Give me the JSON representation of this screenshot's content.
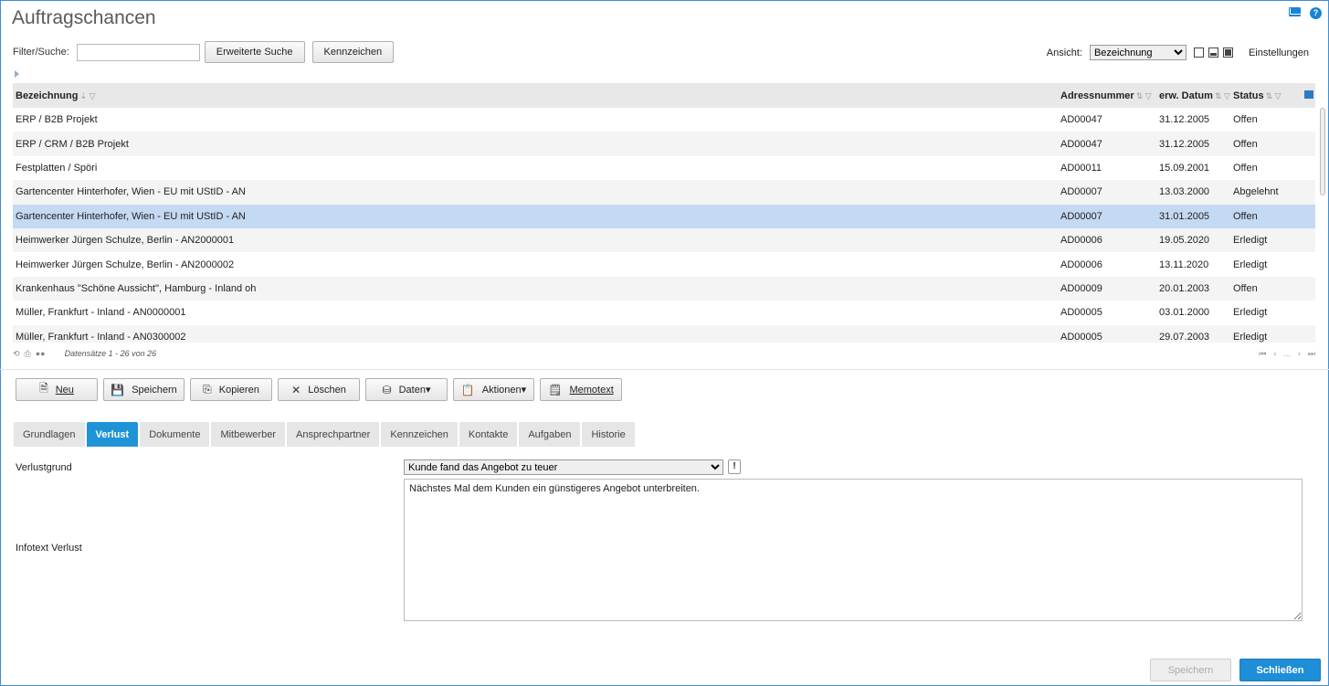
{
  "title": "Auftragschancen",
  "filter": {
    "label": "Filter/Suche:",
    "value": "",
    "advanced_search": "Erweiterte Suche",
    "flags": "Kennzeichen"
  },
  "view": {
    "label": "Ansicht:",
    "selected": "Bezeichnung",
    "settings": "Einstellungen"
  },
  "grid": {
    "headers": [
      "Bezeichnung",
      "Adressnummer",
      "erw. Datum",
      "Status"
    ],
    "rows": [
      {
        "name": "ERP / B2B Projekt",
        "addr": "AD00047",
        "date": "31.12.2005",
        "status": "Offen"
      },
      {
        "name": "ERP / CRM / B2B Projekt",
        "addr": "AD00047",
        "date": "31.12.2005",
        "status": "Offen"
      },
      {
        "name": "Festplatten / Spöri",
        "addr": "AD00011",
        "date": "15.09.2001",
        "status": "Offen"
      },
      {
        "name": "Gartencenter Hinterhofer, Wien - EU mit UStID - AN",
        "addr": "AD00007",
        "date": "13.03.2000",
        "status": "Abgelehnt"
      },
      {
        "name": "Gartencenter Hinterhofer, Wien - EU mit UStID - AN",
        "addr": "AD00007",
        "date": "31.01.2005",
        "status": "Offen"
      },
      {
        "name": "Heimwerker Jürgen Schulze, Berlin - AN2000001",
        "addr": "AD00006",
        "date": "19.05.2020",
        "status": "Erledigt"
      },
      {
        "name": "Heimwerker Jürgen Schulze, Berlin - AN2000002",
        "addr": "AD00006",
        "date": "13.11.2020",
        "status": "Erledigt"
      },
      {
        "name": "Krankenhaus \"Schöne Aussicht\", Hamburg - Inland oh",
        "addr": "AD00009",
        "date": "20.01.2003",
        "status": "Offen"
      },
      {
        "name": "Müller, Frankfurt - Inland - AN0000001",
        "addr": "AD00005",
        "date": "03.01.2000",
        "status": "Erledigt"
      },
      {
        "name": "Müller, Frankfurt - Inland - AN0300002",
        "addr": "AD00005",
        "date": "29.07.2003",
        "status": "Erledigt"
      }
    ],
    "selected_index": 4,
    "record_count": "Datensätze 1 - 26 von 26",
    "pager_ellipsis": "..."
  },
  "actions": {
    "new": "Neu",
    "save": "Speichern",
    "copy": "Kopieren",
    "delete": "Löschen",
    "data": "Daten",
    "actions": "Aktionen",
    "memo": "Memotext"
  },
  "tabs": [
    "Grundlagen",
    "Verlust",
    "Dokumente",
    "Mitbewerber",
    "Ansprechpartner",
    "Kennzeichen",
    "Kontakte",
    "Aufgaben",
    "Historie"
  ],
  "active_tab": "Verlust",
  "form": {
    "reason_label": "Verlustgrund",
    "reason_value": "Kunde fand das Angebot zu teuer",
    "info_label": "Infotext Verlust",
    "info_value": "Nächstes Mal dem Kunden ein günstigeres Angebot unterbreiten."
  },
  "footer": {
    "save": "Speichern",
    "close": "Schließen"
  },
  "colors": {
    "accent": "#1e8ed6",
    "selected_row": "#c4d9f2"
  }
}
